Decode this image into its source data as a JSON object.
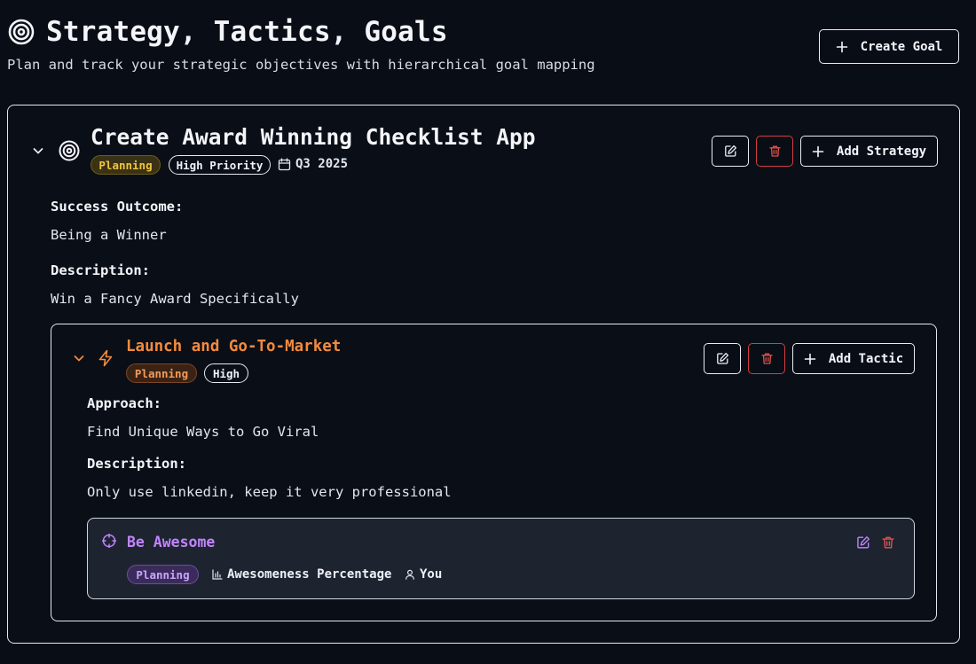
{
  "header": {
    "title": "Strategy, Tactics, Goals",
    "subtitle": "Plan and track your strategic objectives with hierarchical goal mapping",
    "create_goal_label": "Create Goal",
    "icon": "target-icon"
  },
  "goal": {
    "title": "Create Award Winning Checklist App",
    "status": "Planning",
    "priority": "High Priority",
    "timeframe": "Q3 2025",
    "success_outcome_label": "Success Outcome:",
    "success_outcome": "Being a Winner",
    "description_label": "Description:",
    "description": "Win a Fancy Award Specifically",
    "add_strategy_label": "Add Strategy",
    "icons": [
      "chevron-down-icon",
      "target-icon",
      "calendar-icon",
      "edit-icon",
      "trash-icon",
      "plus-icon"
    ],
    "strategy": {
      "title": "Launch and Go-To-Market",
      "status": "Planning",
      "priority": "High",
      "approach_label": "Approach:",
      "approach": "Find Unique Ways to Go Viral",
      "description_label": "Description:",
      "description": "Only use linkedin, keep it very professional",
      "add_tactic_label": "Add Tactic",
      "icons": [
        "chevron-down-icon",
        "lightning-icon",
        "edit-icon",
        "trash-icon",
        "plus-icon"
      ],
      "tactic": {
        "title": "Be Awesome",
        "status": "Planning",
        "metric": "Awesomeness Percentage",
        "owner": "You",
        "icons": [
          "crosshair-icon",
          "bar-chart-icon",
          "user-icon",
          "edit-icon",
          "trash-icon"
        ]
      }
    }
  },
  "colors": {
    "background": "#090d16",
    "strategy_accent": "#f58a3c",
    "tactic_accent": "#c084fc",
    "goal_status": "#f0c53f",
    "danger": "#d3403f",
    "tactic_card_bg": "#1d2430"
  }
}
